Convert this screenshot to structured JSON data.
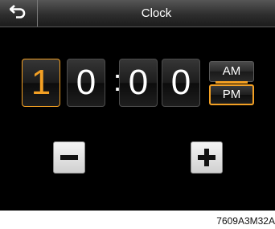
{
  "header": {
    "title": "Clock",
    "back_icon": "back-arrow-icon"
  },
  "time": {
    "hour_tens": "1",
    "hour_ones": "0",
    "separator": ":",
    "minute_tens": "0",
    "minute_ones": "0",
    "selected_field": "hour_tens"
  },
  "ampm": {
    "am_label": "AM",
    "pm_label": "PM",
    "selected": "PM"
  },
  "controls": {
    "decrease_icon": "minus-icon",
    "increase_icon": "plus-icon"
  },
  "caption": "7609A3M32A",
  "colors": {
    "accent": "#f3a024",
    "background": "#000000",
    "text": "#ffffff"
  }
}
